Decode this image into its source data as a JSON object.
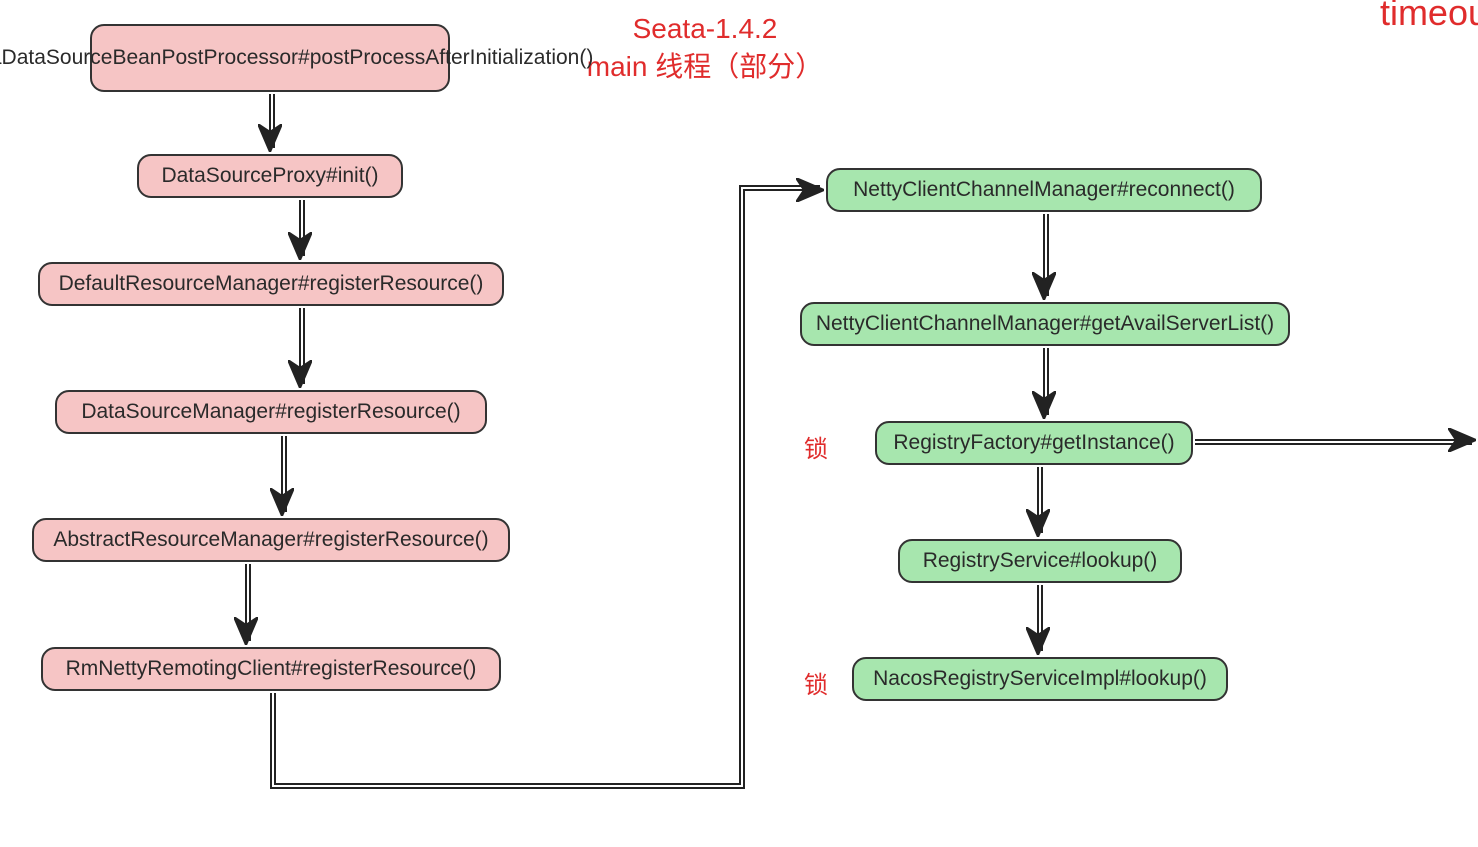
{
  "title_line1": "Seata-1.4.2",
  "title_line2": "main 线程（部分）",
  "corner_fragment": "timeou",
  "lock_label": "锁",
  "left_nodes": {
    "n1": "SeataDataSourceBeanPostProcessor#postProcessAfterInitialization()",
    "n2": "DataSourceProxy#init()",
    "n3": "DefaultResourceManager#registerResource()",
    "n4": "DataSourceManager#registerResource()",
    "n5": "AbstractResourceManager#registerResource()",
    "n6": "RmNettyRemotingClient#registerResource()"
  },
  "right_nodes": {
    "r1": "NettyClientChannelManager#reconnect()",
    "r2": "NettyClientChannelManager#getAvailServerList()",
    "r3": "RegistryFactory#getInstance()",
    "r4": "RegistryService#lookup()",
    "r5": "NacosRegistryServiceImpl#lookup()"
  }
}
